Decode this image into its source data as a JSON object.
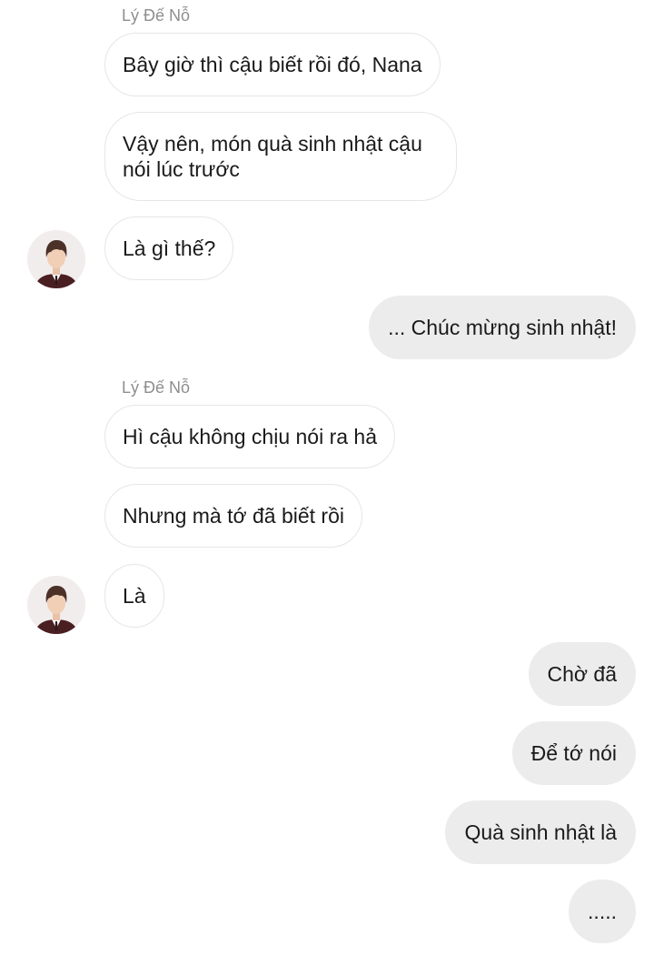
{
  "chat": {
    "contact_name": "Lý Đế Nỗ",
    "messages": [
      {
        "from": "contact",
        "text": "Bây giờ thì cậu biết rồi đó, Nana"
      },
      {
        "from": "contact",
        "text": "Vậy nên, món quà sinh nhật cậu nói lúc trước"
      },
      {
        "from": "contact",
        "text": "Là gì thế?"
      },
      {
        "from": "me",
        "text": "... Chúc mừng sinh nhật!"
      },
      {
        "from": "contact",
        "text": "Hì cậu không chịu nói ra hả"
      },
      {
        "from": "contact",
        "text": "Nhưng mà tớ đã biết rồi"
      },
      {
        "from": "contact",
        "text": "Là"
      },
      {
        "from": "me",
        "text": "Chờ đã"
      },
      {
        "from": "me",
        "text": "Để tớ nói"
      },
      {
        "from": "me",
        "text": "Quà sinh nhật là"
      },
      {
        "from": "me",
        "text": "....."
      }
    ]
  },
  "colors": {
    "incoming_bubble_bg": "#ffffff",
    "incoming_bubble_border": "#e6e6e6",
    "outgoing_bubble_bg": "#ececec",
    "sender_name": "#8e8e8e",
    "text": "#1a1a1a"
  },
  "icons": {
    "avatar": "contact-profile-photo"
  }
}
